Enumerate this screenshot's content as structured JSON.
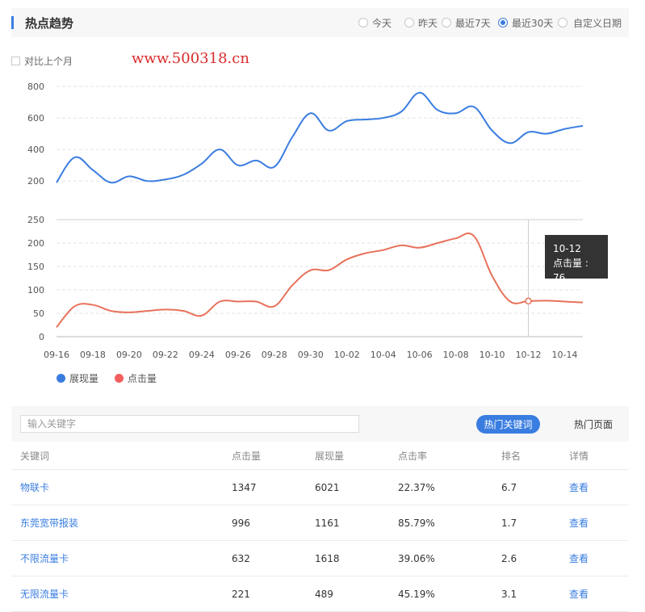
{
  "header": {
    "title": "热点趋势",
    "ranges": [
      {
        "label": "今天",
        "selected": false
      },
      {
        "label": "昨天",
        "selected": false
      },
      {
        "label": "最近7天",
        "selected": false
      },
      {
        "label": "最近30天",
        "selected": true
      },
      {
        "label": "自定义日期",
        "selected": false
      }
    ]
  },
  "compare_label": "对比上个月",
  "watermark": "www.500318.cn",
  "chart_data": {
    "type": "line",
    "x": [
      "09-16",
      "09-17",
      "09-18",
      "09-19",
      "09-20",
      "09-21",
      "09-22",
      "09-23",
      "09-24",
      "09-25",
      "09-26",
      "09-27",
      "09-28",
      "09-29",
      "09-30",
      "10-01",
      "10-02",
      "10-03",
      "10-04",
      "10-05",
      "10-06",
      "10-07",
      "10-08",
      "10-09",
      "10-10",
      "10-11",
      "10-12",
      "10-13",
      "10-14",
      "10-15"
    ],
    "x_tick_labels": [
      "09-16",
      "09-18",
      "09-20",
      "09-22",
      "09-24",
      "09-26",
      "09-28",
      "09-30",
      "10-02",
      "10-04",
      "10-06",
      "10-08",
      "10-10",
      "10-12",
      "10-14"
    ],
    "panels": [
      {
        "y_ticks": [
          200,
          400,
          600,
          800
        ],
        "ylim": [
          160,
          800
        ],
        "series": [
          {
            "name": "展现量",
            "color": "#3a7de0",
            "values": [
              190,
              350,
              270,
              190,
              230,
              200,
              210,
              240,
              310,
              400,
              300,
              330,
              290,
              480,
              630,
              520,
              580,
              590,
              600,
              640,
              760,
              650,
              630,
              670,
              520,
              440,
              510,
              500,
              530,
              550
            ]
          }
        ]
      },
      {
        "y_ticks": [
          0,
          50,
          100,
          150,
          200,
          250
        ],
        "ylim": [
          0,
          250
        ],
        "series": [
          {
            "name": "点击量",
            "color": "#e8715a",
            "values": [
              20,
              65,
              68,
              55,
              52,
              55,
              58,
              55,
              45,
              75,
              75,
              75,
              65,
              110,
              142,
              142,
              165,
              178,
              185,
              195,
              190,
              200,
              210,
              215,
              130,
              75,
              76,
              77,
              75,
              73
            ]
          }
        ]
      }
    ],
    "tooltip": {
      "date": "10-12",
      "label": "点击量 : 76",
      "index": 26
    }
  },
  "legend": [
    {
      "label": "展现量",
      "color": "#3a7de0"
    },
    {
      "label": "点击量",
      "color": "#f25f5c"
    }
  ],
  "toolbar": {
    "search_placeholder": "输入关键字",
    "tab_keywords": "热门关键词",
    "tab_pages": "热门页面"
  },
  "table": {
    "headers": [
      "关键词",
      "点击量",
      "展现量",
      "点击率",
      "排名",
      "详情"
    ],
    "rows": [
      {
        "keyword": "物联卡",
        "clicks": "1347",
        "impressions": "6021",
        "ctr": "22.37%",
        "rank": "6.7",
        "detail": "查看"
      },
      {
        "keyword": "东莞宽带报装",
        "clicks": "996",
        "impressions": "1161",
        "ctr": "85.79%",
        "rank": "1.7",
        "detail": "查看"
      },
      {
        "keyword": "不限流量卡",
        "clicks": "632",
        "impressions": "1618",
        "ctr": "39.06%",
        "rank": "2.6",
        "detail": "查看"
      },
      {
        "keyword": "无限流量卡",
        "clicks": "221",
        "impressions": "489",
        "ctr": "45.19%",
        "rank": "3.1",
        "detail": "查看"
      }
    ]
  }
}
